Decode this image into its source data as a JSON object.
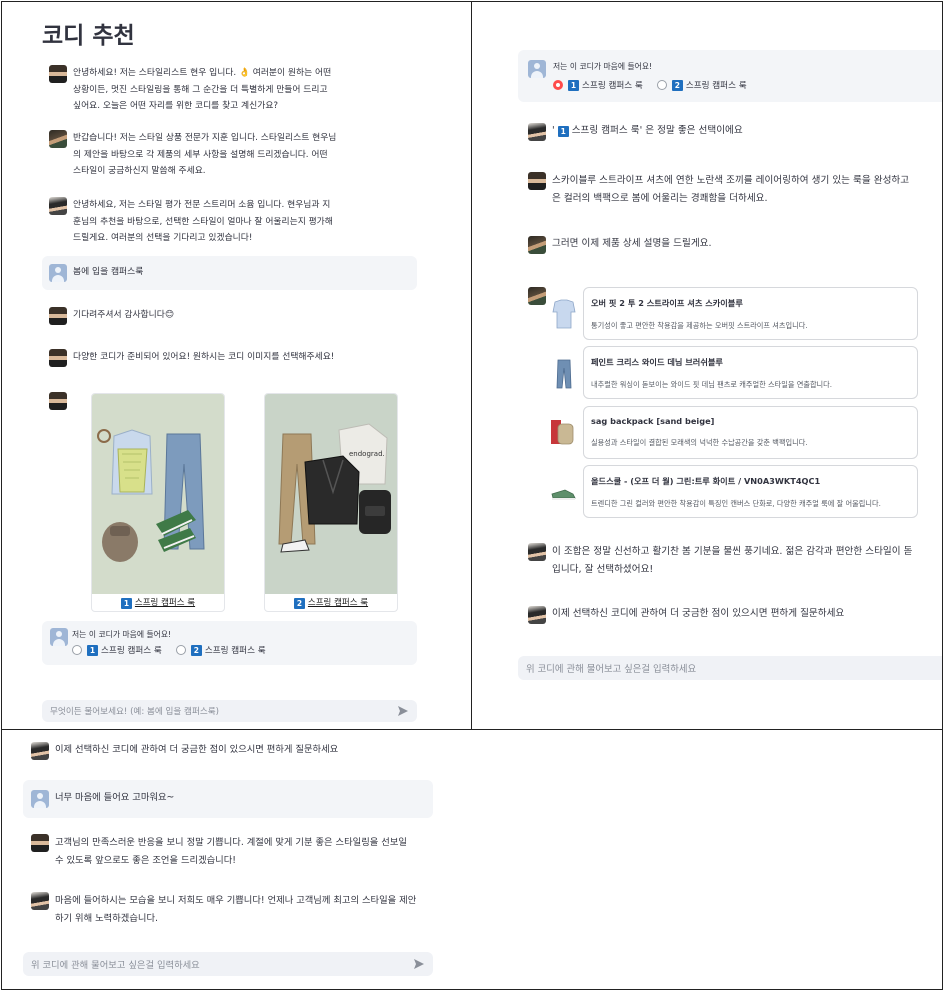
{
  "left": {
    "title": "코디 추천",
    "messages": [
      {
        "speaker": "hyunwoo",
        "text": "안녕하세요! 저는 스타일리스트 현우 입니다. 👌 여러분이 원하는 어떤\n상황이든, 멋진 스타일링을 통해 그 순간을 더 특별하게 만들어 드리고\n싶어요. 오늘은 어떤 자리를 위한 코디를 찾고 계신가요?"
      },
      {
        "speaker": "jihoon",
        "text": "반갑습니다! 저는 스타일 상품 전문가 지훈 입니다. 스타일리스트 현우님\n의 제안을 바탕으로 각 제품의 세부 사항을 설명해 드리겠습니다. 어떤\n스타일이 궁금하신지 말씀해 주세요."
      },
      {
        "speaker": "soyoung",
        "text": "안녕하세요, 저는 스타일 평가 전문 스트리머 소윰 입니다. 현우님과 지\n훈님의 추천을 바탕으로, 선택한 스타일이 얼마나 잘 어울리는지 평가해\n드릴게요. 여러분의 선택을 기다리고 있겠습니다!"
      },
      {
        "speaker": "user",
        "text": "봄에 입을 캠퍼스룩"
      },
      {
        "speaker": "hyunwoo",
        "text": "기다려주셔서 감사합니다😊"
      },
      {
        "speaker": "hyunwoo",
        "text": "다양한 코디가 준비되어 있어요! 원하시는 코디 이미지를 선택해주세요!"
      }
    ],
    "outfits": [
      {
        "num": "1",
        "label": "스프링 캠퍼스 룩"
      },
      {
        "num": "2",
        "label": "스프링 캠퍼스 룩"
      }
    ],
    "chooser": {
      "question": "저는 이 코디가 마음에 들어요!",
      "options": [
        {
          "num": "1",
          "label": "스프링 캠퍼스 룩",
          "selected": false
        },
        {
          "num": "2",
          "label": "스프링 캠퍼스 룩",
          "selected": false
        }
      ]
    },
    "input_placeholder": "무엇이든 물어보세요! (예: 봄에 입을 캠퍼스룩)",
    "photo_tags": {
      "sweater_text": "endograd."
    }
  },
  "right": {
    "chooser": {
      "question": "저는 이 코디가 마음에 들어요!",
      "options": [
        {
          "num": "1",
          "label": "스프링 캠퍼스 룩",
          "selected": true
        },
        {
          "num": "2",
          "label": "스프링 캠퍼스 룩",
          "selected": false
        }
      ]
    },
    "selected_msg": {
      "prefix": "' ",
      "num": "1",
      "label": "스프링 캠퍼스 룩",
      "suffix": "' 은 정말 좋은 선택이에요"
    },
    "hyunwoo_desc": "스카이블루 스트라이프 셔츠에 연한 노란색 조끼를 레이어링하여 생기 있는 룩을 완성하고\n은 컬러의 백팩으로 봄에 어울리는 경쾌함을 더하세요.",
    "jihoon_intro": "그러면 이제 제품 상세 설명을 드릴게요.",
    "products": [
      {
        "name": "오버 핏 2 투 2 스트라이프 셔츠 스카이블루",
        "desc": "통기성이 좋고 편안한 착용감을 제공하는 오버핏 스트라이프 셔츠입니다.",
        "icon": "shirt-thumb"
      },
      {
        "name": "페인트 크리스 와이드 데님 브러쉬블루",
        "desc": "내추럴한 워싱이 돋보이는 와이드 핏 데님 팬츠로 캐주얼한 스타일을 연출합니다.",
        "icon": "jeans-thumb"
      },
      {
        "name": "sag backpack [sand beige]",
        "desc": "실용성과 스타일이 결합된 모래색의 넉넉한 수납공간을 갖춘 백팩입니다.",
        "icon": "backpack-thumb"
      },
      {
        "name": "올드스쿨 - (오프 더 월) 그린:트루 화이트 / VN0A3WKT4QC1",
        "desc": "트렌디한 그린 컬러와 편안한 착용감이 특징인 캔버스 단화로, 다양한 캐주얼 룩에 잘 어울립니다.",
        "icon": "sneaker-thumb"
      }
    ],
    "soyoung_eval": "이 조합은 정말 신선하고 활기찬 봄 기분을 물씬 풍기네요. 젊은 감각과 편안한 스타일이 돋\n입니다, 잘 선택하셨어요!",
    "soyoung_ask": "이제 선택하신 코디에 관하여 더 궁금한 점이 있으시면 편하게 질문하세요",
    "input_placeholder": "위 코디에 관해 물어보고 싶은걸 입력하세요"
  },
  "bottom": {
    "soyoung_ask": "이제 선택하신 코디에 관하여 더 궁금한 점이 있으시면 편하게 질문하세요",
    "user_msg": "너무 마음에 들어요 고마워요~",
    "hyunwoo_reply": "고객님의 만족스러운 반응을 보니 정말 기쁩니다. 계절에 맞게 기분 좋은 스타일링을 선보일\n수 있도록 앞으로도 좋은 조언을 드리겠습니다!",
    "soyoung_reply": "마음에 들어하시는 모습을 보니 저희도 매우 기쁩니다! 언제나 고객님께 최고의 스타일을 제안\n하기 위해 노력하겠습니다.",
    "input_placeholder": "위 코디에 관해 물어보고 싶은걸 입력하세요"
  },
  "colors": {
    "accent_red": "#ff4b4b",
    "num_badge": "#1f6fbf",
    "chat_bg": "#f3f5f8",
    "input_bg": "#f0f2f6"
  }
}
